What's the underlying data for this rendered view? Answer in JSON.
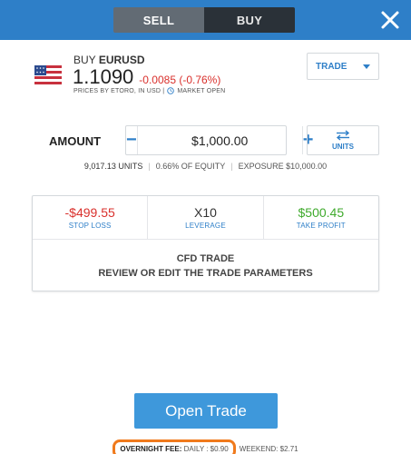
{
  "header": {
    "sell_label": "SELL",
    "buy_label": "BUY"
  },
  "instrument": {
    "action": "BUY",
    "symbol": "EURUSD",
    "price": "1.1090",
    "change": "-0.0085 (-0.76%)",
    "meta_text": "PRICES BY ETORO, IN USD |",
    "market_status": "MARKET OPEN",
    "flag_icon": "us-flag-icon"
  },
  "order_type": {
    "selected": "TRADE"
  },
  "amount": {
    "label": "AMOUNT",
    "value": "$1,000.00",
    "minus": "−",
    "plus": "+",
    "units_label": "UNITS"
  },
  "info": {
    "units": "9,017.13 UNITS",
    "equity": "0.66% OF EQUITY",
    "exposure": "EXPOSURE $10,000.00"
  },
  "params": {
    "stop_loss_value": "-$499.55",
    "stop_loss_label": "STOP LOSS",
    "leverage_value": "X10",
    "leverage_label": "LEVERAGE",
    "take_profit_value": "$500.45",
    "take_profit_label": "TAKE PROFIT"
  },
  "cfd": {
    "line1": "CFD TRADE",
    "line2": "REVIEW OR EDIT THE TRADE PARAMETERS"
  },
  "open_trade_label": "Open Trade",
  "fees": {
    "overnight_label": "OVERNIGHT FEE:",
    "daily": "DAILY : $0.90",
    "weekend": "WEEKEND: $2.71"
  },
  "colors": {
    "header_blue": "#2e7fc8",
    "button_blue": "#3e98db",
    "negative_red": "#d9302c",
    "positive_green": "#3faa2c",
    "highlight_orange": "#f07a1c"
  }
}
